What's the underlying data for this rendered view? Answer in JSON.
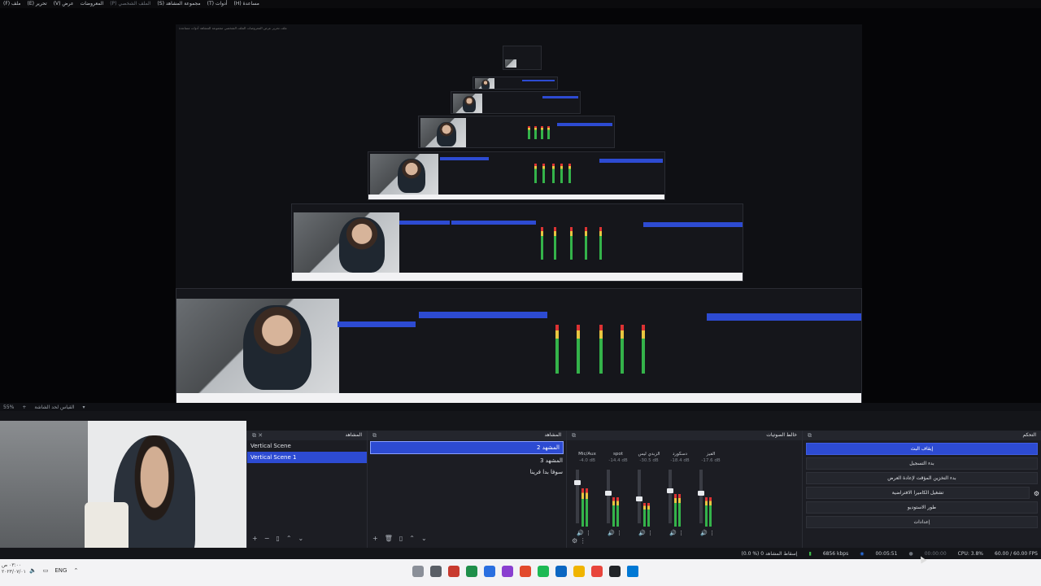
{
  "menubar": {
    "items": [
      "ملف (F)",
      "تحرير (E)",
      "عرض (V)",
      "المعروضات",
      "الملف الشخصي (P)",
      "مجموعة المشاهد (S)",
      "أدوات (T)",
      "مساعدة (H)"
    ]
  },
  "preview_bar": {
    "zoom": "55%",
    "label": "القياس لحد الشاشة"
  },
  "docks": {
    "scenes": {
      "title": "المشاهد",
      "items": [
        "Vertical Scene",
        "Vertical Scene 1"
      ],
      "selected_index": 1,
      "header_label": "Vertical"
    },
    "sources": {
      "title": "المشاهد",
      "items": [
        "المشهد 2",
        "المشهد 3",
        "سوفا بدا فرينا"
      ],
      "selected_index": 0
    },
    "mixer": {
      "title": "خالط الصوتيات",
      "channels": [
        {
          "name": "Mic/Aux",
          "db": "-4.0 dB",
          "level": 0.65,
          "fader": 0.8
        },
        {
          "name": "spot",
          "db": "-14.4 dB",
          "level": 0.5,
          "fader": 0.6
        },
        {
          "name": "الزبدي ليس",
          "db": "-30.5 dB",
          "level": 0.4,
          "fader": 0.5
        },
        {
          "name": "دسكورد",
          "db": "-18.4 dB",
          "level": 0.55,
          "fader": 0.65
        },
        {
          "name": "الفيز",
          "db": "-17.6 dB",
          "level": 0.5,
          "fader": 0.6
        }
      ],
      "scale": [
        "0",
        "-5",
        "-10",
        "-15",
        "-20",
        "-25",
        "-30",
        "-35",
        "-40",
        "-45",
        "-50",
        "-55",
        "-60"
      ]
    },
    "controls": {
      "title": "التحكم",
      "buttons": [
        {
          "label": "إيقاف البث",
          "primary": true
        },
        {
          "label": "بدء التسجيل",
          "primary": false
        },
        {
          "label": "بدء التخزين المؤقت لإعادة العرض",
          "primary": false
        },
        {
          "label": "تشغيل الكاميرا الافتراضية",
          "primary": false
        },
        {
          "label": "طور الاستوديو",
          "primary": false
        },
        {
          "label": "إعدادات",
          "primary": false
        }
      ]
    }
  },
  "status": {
    "dropped": "(0.0 %) إسقاط المشاهد 0",
    "bitrate": "6856 kbps",
    "live_time": "00:05:51",
    "rec_time": "00:00:00",
    "cpu": "CPU: 3.8%",
    "fps": "60.00 / 60.00 FPS"
  },
  "taskbar": {
    "time": "٠٣:٠٠ ص",
    "date": "٢٠٢٣/٠٧/٠١",
    "lang": "ENG",
    "colors": [
      "#8a8f98",
      "#5a5f66",
      "#c83a2e",
      "#1f8f4a",
      "#2a6fe0",
      "#8a3fd0",
      "#e24a2c",
      "#1db954",
      "#0a66c2",
      "#f0b400",
      "#e8453c",
      "#222428",
      "#0078d4"
    ]
  }
}
